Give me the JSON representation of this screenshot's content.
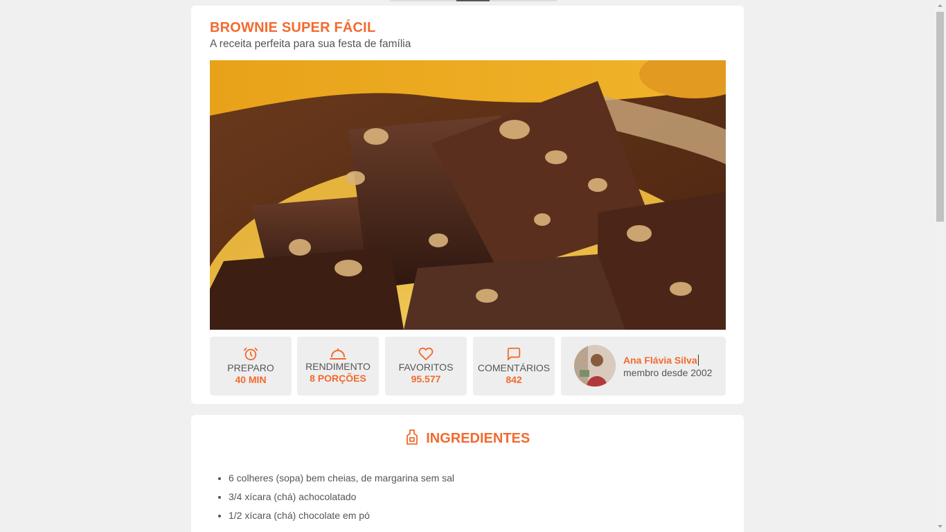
{
  "recipe": {
    "title": "BROWNIE SUPER FÁCIL",
    "subtitle": "A receita perfeita para sua festa de família"
  },
  "stats": [
    {
      "icon": "alarm-clock-icon",
      "label": "PREPARO",
      "value": "40 MIN"
    },
    {
      "icon": "serving-dish-icon",
      "label": "RENDIMENTO",
      "value": "8 PORÇÕES"
    },
    {
      "icon": "heart-icon",
      "label": "FAVORITOS",
      "value": "95.577"
    },
    {
      "icon": "comment-icon",
      "label": "COMENTÁRIOS",
      "value": "842"
    }
  ],
  "author": {
    "name": "Ana Flávia Silva",
    "since": "membro desde 2002"
  },
  "ingredients": {
    "icon": "chef-apron-icon",
    "heading": "INGREDIENTES",
    "items": [
      "6 colheres (sopa) bem cheias, de margarina sem sal",
      "3/4 xícara (chá) achocolatado",
      "1/2 xícara (chá) chocolate em pó"
    ]
  },
  "colors": {
    "accent": "#f26a2e",
    "background": "#f0f0f0",
    "stat_bg": "#eeeeee"
  }
}
